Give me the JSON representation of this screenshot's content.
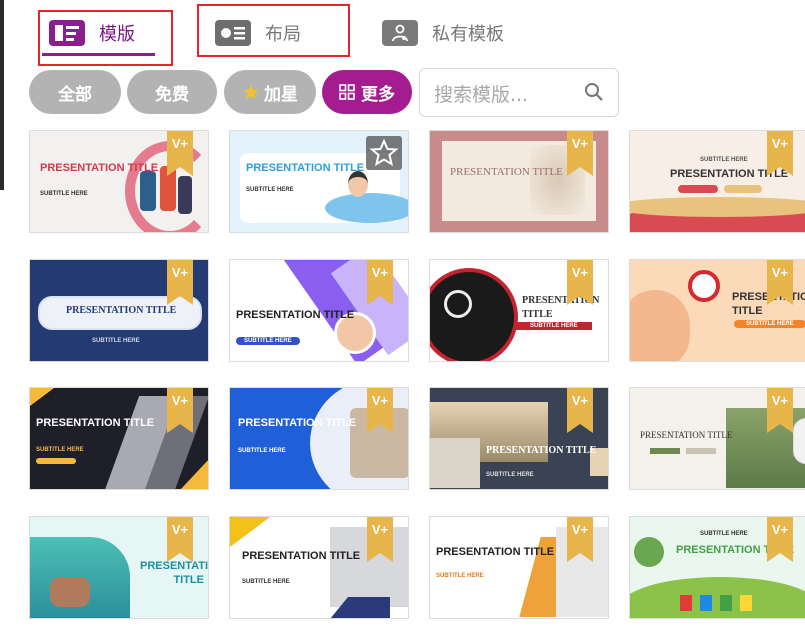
{
  "tabs": {
    "templates": {
      "label": "模版"
    },
    "layout": {
      "label": "布局"
    },
    "private": {
      "label": "私有模板"
    }
  },
  "filters": {
    "all": "全部",
    "free": "免费",
    "starred": "加星",
    "more": "更多"
  },
  "search": {
    "placeholder": "搜索模版..."
  },
  "badge_text": "V+",
  "templates": [
    {
      "title": "PRESENTATION TITLE",
      "subtitle": "SUBTITLE HERE"
    },
    {
      "title": "PRESENTATION TITLE",
      "subtitle": "SUBTITLE HERE"
    },
    {
      "title": "PRESENTATION TITLE",
      "subtitle": ""
    },
    {
      "title": "PRESENTATION TITLE",
      "subtitle": "SUBTITLE HERE"
    },
    {
      "title": "PRESENTATION TITLE",
      "subtitle": "SUBTITLE HERE"
    },
    {
      "title": "PRESENTATION TITLE",
      "subtitle": "SUBTITLE HERE"
    },
    {
      "title": "PRESENTATION TITLE",
      "subtitle": "SUBTITLE HERE"
    },
    {
      "title": "PRESENTATION TITLE",
      "subtitle": "SUBTITLE HERE"
    },
    {
      "title": "PRESENTATION TITLE",
      "subtitle": "SUBTITLE HERE"
    },
    {
      "title": "PRESENTATION TITLE",
      "subtitle": "SUBTITLE HERE"
    },
    {
      "title": "PRESENTATION TITLE",
      "subtitle": "SUBTITLE HERE"
    },
    {
      "title": "PRESENTATION TITLE",
      "subtitle": ""
    },
    {
      "title": "PRESENTATION TITLE",
      "subtitle": ""
    },
    {
      "title": "PRESENTATION TITLE",
      "subtitle": "SUBTITLE HERE"
    },
    {
      "title": "PRESENTATION TITLE",
      "subtitle": "SUBTITLE HERE"
    },
    {
      "title": "PRESENTATION TITLE",
      "subtitle": "SUBTITLE HERE"
    }
  ],
  "colors": {
    "accent": "#8a1e8e",
    "highlight_box": "#e3262a",
    "badge": "#e8b54b"
  }
}
